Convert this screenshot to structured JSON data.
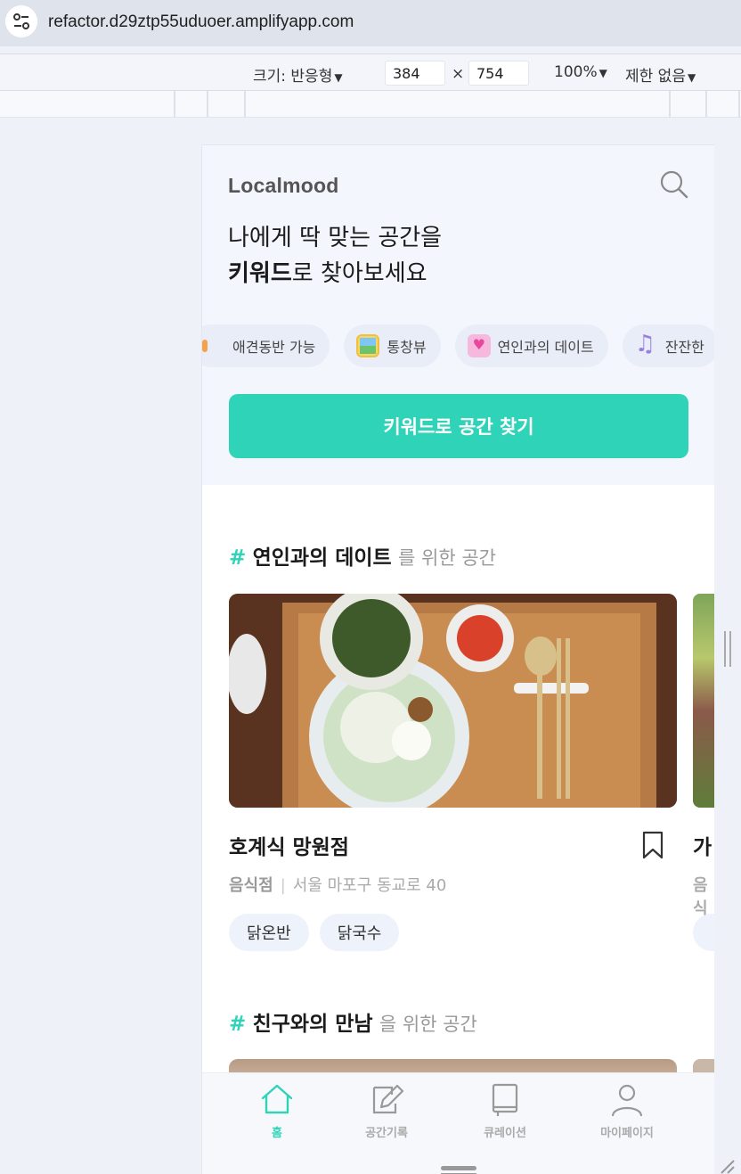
{
  "browser": {
    "url": "refactor.d29ztp55uduoer.amplifyapp.com"
  },
  "devtools": {
    "size_label": "크기: 반응형",
    "width": "384",
    "times": "×",
    "height": "754",
    "zoom": "100%",
    "throttle": "제한 없음",
    "caret": "▼"
  },
  "app": {
    "logo": "Localmood",
    "headline_line1": "나에게 딱 맞는 공간을",
    "headline_strong": "키워드",
    "headline_line2_rest": "로 찾아보세요",
    "chips": [
      {
        "label": "애견동반 가능",
        "icon": "dog-icon"
      },
      {
        "label": "통창뷰",
        "icon": "window-view-icon"
      },
      {
        "label": "연인과의 데이트",
        "icon": "heart-icon"
      },
      {
        "label": "잔잔한",
        "icon": "music-icon"
      }
    ],
    "cta": "키워드로 공간 찾기",
    "sections": [
      {
        "hash": "#",
        "keyword": "연인과의 데이트",
        "suffix": "를 위한 공간",
        "card": {
          "name": "호계식 망원점",
          "category": "음식점",
          "separator": "|",
          "address": "서울 마포구 동교로 40",
          "tags": [
            "닭온반",
            "닭국수"
          ]
        },
        "next_peek_name": "가",
        "next_peek_category": "음식"
      },
      {
        "hash": "#",
        "keyword": "친구와의 만남",
        "suffix": "을 위한 공간"
      }
    ],
    "nav": [
      {
        "label": "홈",
        "icon": "home-icon",
        "active": true
      },
      {
        "label": "공간기록",
        "icon": "edit-note-icon",
        "active": false
      },
      {
        "label": "큐레이션",
        "icon": "book-icon",
        "active": false
      },
      {
        "label": "마이페이지",
        "icon": "user-icon",
        "active": false
      }
    ]
  },
  "colors": {
    "accent": "#2fd3b8",
    "hero_bg": "#f3f6fc",
    "chip_bg": "#e8edf8"
  }
}
